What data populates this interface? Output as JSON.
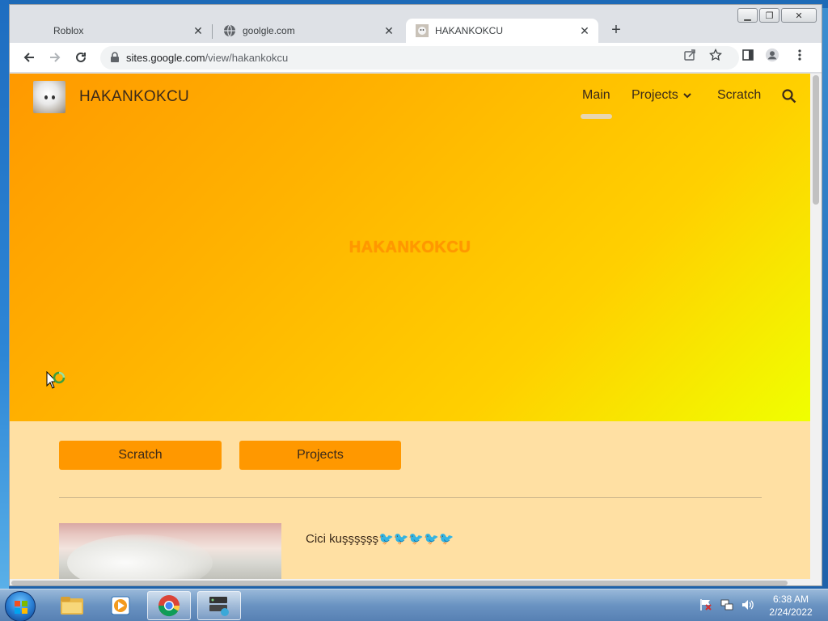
{
  "browser": {
    "tabs": [
      {
        "title": "Roblox",
        "active": false,
        "icon": "none"
      },
      {
        "title": "goolgle.com",
        "active": false,
        "icon": "globe-icon"
      },
      {
        "title": "HAKANKOKCU",
        "active": true,
        "icon": "site-favicon"
      }
    ],
    "new_tab_label": "+",
    "url_host": "sites.google.com",
    "url_path": "/view/hakankokcu"
  },
  "site": {
    "title": "HAKANKOKCU",
    "nav": {
      "main": "Main",
      "projects": "Projects",
      "scratch": "Scratch"
    },
    "hero_heading": "HAKANKOKCU",
    "buttons": {
      "scratch": "Scratch",
      "projects": "Projects"
    },
    "caption": "Cici kuşşşşşş🐦🐦🐦🐦🐦"
  },
  "taskbar": {
    "time": "6:38 AM",
    "date": "2/24/2022"
  },
  "colors": {
    "hero_start": "#ff9900",
    "hero_end": "#f0ff00",
    "button": "#ff9800",
    "page_bg": "#ffe0a3"
  }
}
